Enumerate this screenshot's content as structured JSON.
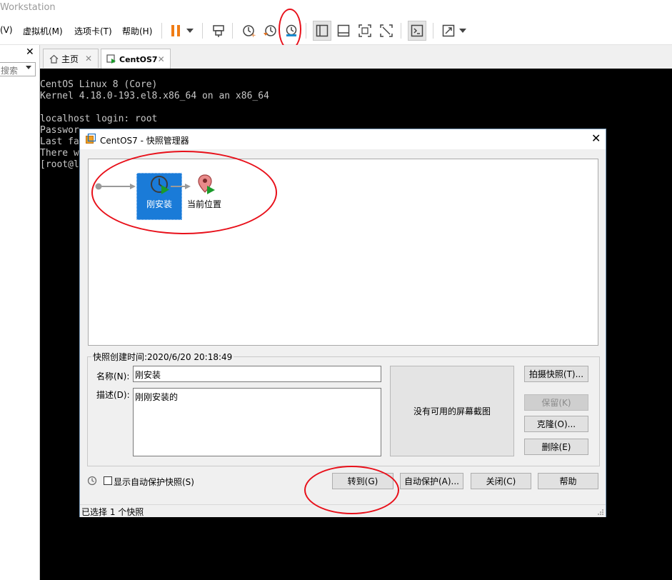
{
  "window": {
    "title": "Workstation"
  },
  "menu": {
    "items": [
      {
        "label": "(V)"
      },
      {
        "label": "虚拟机(M)"
      },
      {
        "label": "选项卡(T)"
      },
      {
        "label": "帮助(H)"
      }
    ]
  },
  "sidebar": {
    "search_placeholder": "搜索",
    "close": "✕"
  },
  "tabs": [
    {
      "label": "主页",
      "close": "✕"
    },
    {
      "label": "CentOS7",
      "close": "✕"
    }
  ],
  "console": {
    "lines": [
      "CentOS Linux 8 (Core)",
      "Kernel 4.18.0-193.el8.x86_64 on an x86_64",
      "",
      "localhost login: root",
      "Passwor",
      "Last fa",
      "There w",
      "[root@l"
    ]
  },
  "dialog": {
    "title": "CentOS7 - 快照管理器",
    "close": "✕",
    "snapshot_node": "刚安装",
    "current_position": "当前位置",
    "created_time": "快照创建时间:2020/6/20 20:18:49",
    "name_label": "名称(N):",
    "name_value": "刚安装",
    "desc_label": "描述(D):",
    "desc_value": "刚刚安装的",
    "no_screenshot": "没有可用的屏幕截图",
    "buttons": {
      "take_snapshot": "拍摄快照(T)...",
      "keep": "保留(K)",
      "clone": "克隆(O)...",
      "delete": "删除(E)",
      "goto": "转到(G)",
      "autoprotect": "自动保护(A)...",
      "close": "关闭(C)",
      "help": "帮助"
    },
    "show_autoprotect": "显示自动保护快照(S)",
    "status": "已选择 1 个快照"
  },
  "colors": {
    "accent": "#1a7bd8",
    "annotation": "#e8101a",
    "pause": "#f07c14"
  }
}
